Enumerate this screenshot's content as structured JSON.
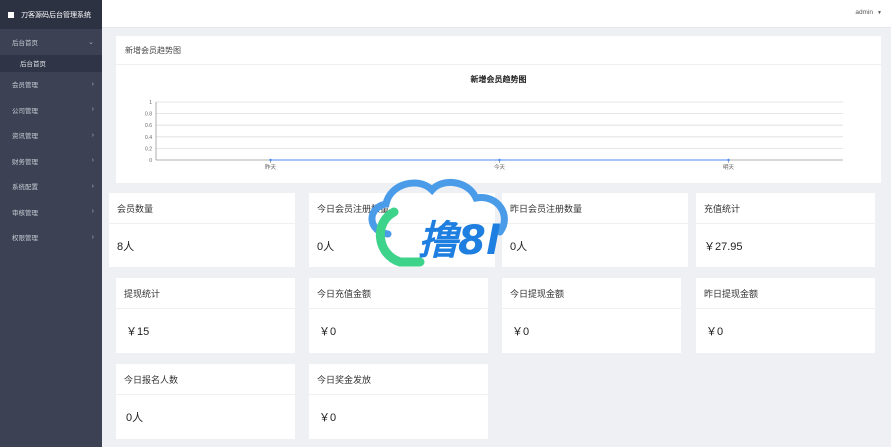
{
  "sidebar": {
    "brand": "刀客源码后台管理系统",
    "items": [
      {
        "label": "后台首页",
        "open": true,
        "sub": [
          "后台首页"
        ]
      },
      {
        "label": "会员管理"
      },
      {
        "label": "公司管理"
      },
      {
        "label": "资讯管理"
      },
      {
        "label": "财务管理"
      },
      {
        "label": "系统配置"
      },
      {
        "label": "审核管理"
      },
      {
        "label": "权限管理"
      }
    ]
  },
  "topbar": {
    "user": "admin"
  },
  "chart_panel": {
    "header": "新增会员趋势图"
  },
  "chart_data": {
    "type": "line",
    "title": "新增会员趋势图",
    "categories": [
      "昨天",
      "今天",
      "明天"
    ],
    "series": [
      {
        "values": [
          0,
          0,
          0
        ]
      }
    ],
    "y_ticks": [
      "0",
      "0.2",
      "0.4",
      "0.6",
      "0.8",
      "1"
    ],
    "ylim": [
      0,
      1
    ],
    "grid": true,
    "line_color": "#4c8af0"
  },
  "cards": [
    {
      "title": "会员数量",
      "value": "8人"
    },
    {
      "title": "今日会员注册数量",
      "value": "0人"
    },
    {
      "title": "昨日会员注册数量",
      "value": "0人"
    },
    {
      "title": "充值统计",
      "value": "￥27.95"
    },
    {
      "title": "提现统计",
      "value": "￥15"
    },
    {
      "title": "今日充值金额",
      "value": "￥0"
    },
    {
      "title": "今日提现金额",
      "value": "￥0"
    },
    {
      "title": "昨日提现金额",
      "value": "￥0"
    },
    {
      "title": "今日报名人数",
      "value": "0人"
    },
    {
      "title": "今日奖金发放",
      "value": "￥0"
    }
  ],
  "watermark": {
    "text": "撸8l",
    "colors": [
      "#4a9be8",
      "#2ecc71"
    ]
  }
}
